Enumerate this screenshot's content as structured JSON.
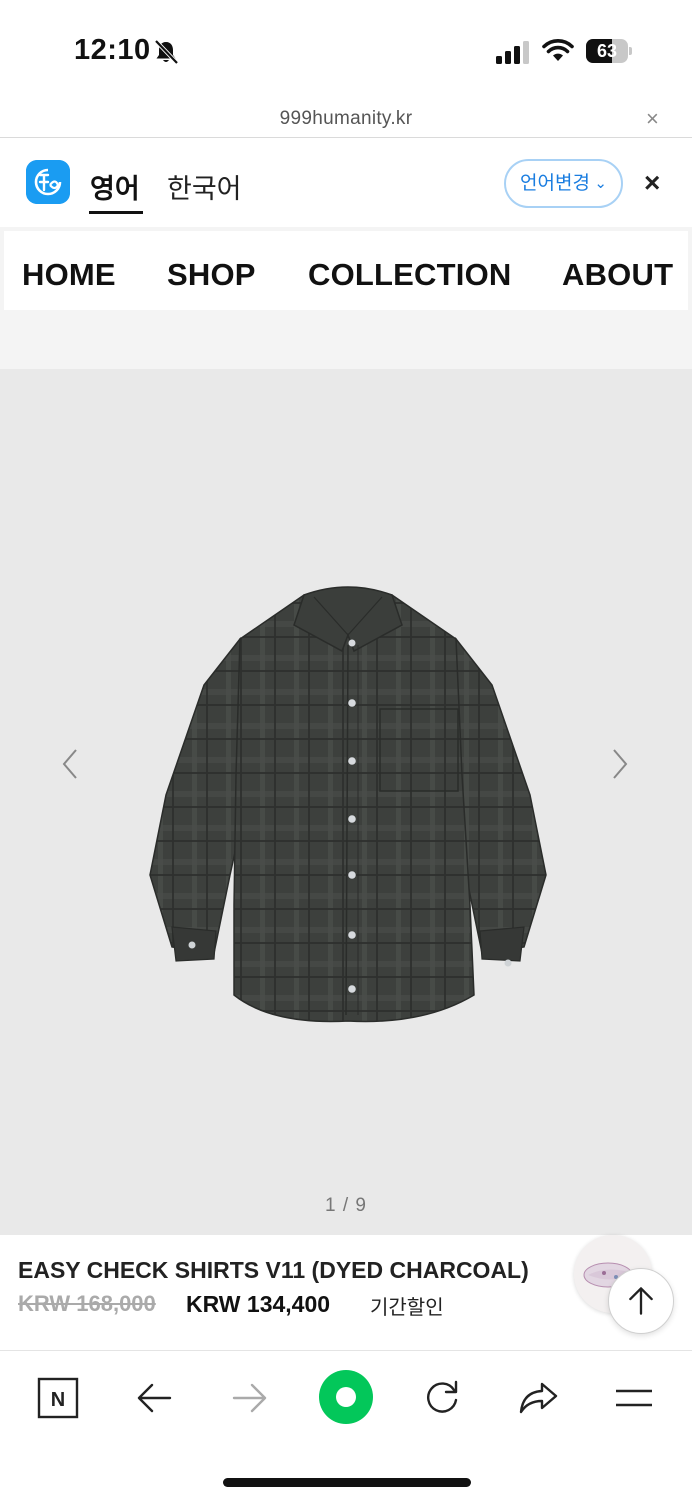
{
  "status_bar": {
    "time": "12:10",
    "battery_level": "63",
    "battery_fraction": 0.63,
    "icons": [
      "bell-slash-icon",
      "signal-icon",
      "wifi-icon",
      "battery-icon"
    ]
  },
  "browser": {
    "url": "999humanity.kr",
    "close_icon": "×"
  },
  "translate_bar": {
    "logo_icon": "translate-logo-icon",
    "tabs": [
      "영어",
      "한국어"
    ],
    "active_tab": "영어",
    "change_language_label": "언어변경",
    "close_icon": "×",
    "accent_color": "#1a9cf2"
  },
  "nav": {
    "items": [
      "HOME",
      "SHOP",
      "COLLECTION",
      "ABOUT"
    ]
  },
  "gallery": {
    "counter": "1 / 9",
    "current": 1,
    "total": 9,
    "prev_icon": "chevron-left-icon",
    "next_icon": "chevron-right-icon",
    "image": "shirt-photo"
  },
  "product": {
    "title": "EASY CHECK SHIRTS V11 (DYED CHARCOAL)",
    "original_price": "KRW 168,000",
    "sale_price": "KRW 134,400",
    "sale_note": "기간할인"
  },
  "toolbar": {
    "icons": [
      "naver-n-icon",
      "back-arrow-icon",
      "forward-arrow-icon",
      "green-dot-home-icon",
      "reload-icon",
      "share-icon",
      "menu-icon"
    ],
    "home_color": "#03c75a",
    "n_label": "N"
  }
}
